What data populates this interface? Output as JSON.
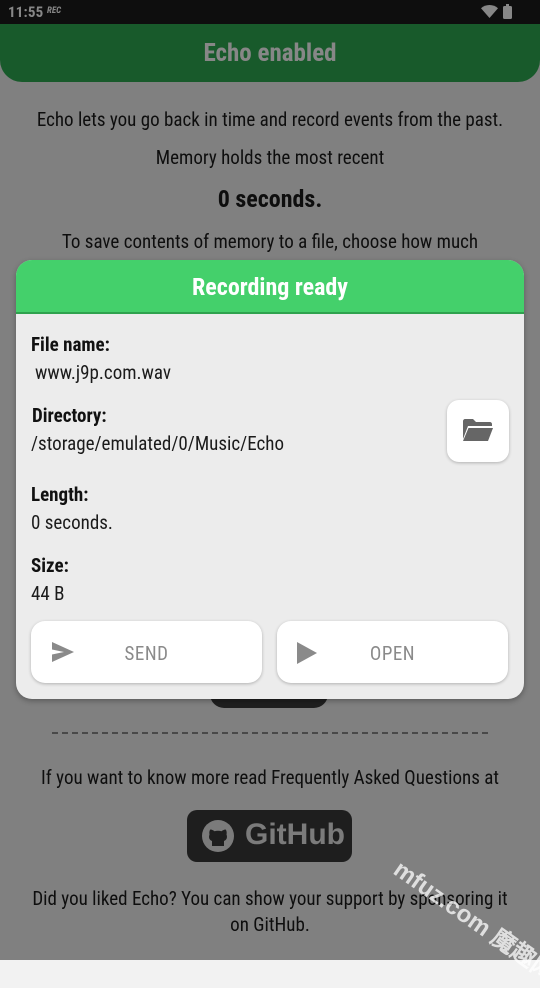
{
  "status_bar": {
    "time": "11:55",
    "rec": "REC"
  },
  "app": {
    "title": "Echo enabled",
    "intro": "Echo lets you go back in time and record events from the past.",
    "memory_label": "Memory holds the most recent",
    "memory_value": "0 seconds.",
    "save_hint": "To save contents of memory to a file, choose how much",
    "faq_text": "If you want to know more read Frequently Asked Questions at",
    "github_label": "GitHub",
    "support_line1": "Did you liked Echo? You can show your support by sponsoring it",
    "support_line2": "on GitHub."
  },
  "dialog": {
    "title": "Recording ready",
    "file_name_label": "File name:",
    "file_name": "www.j9p.com.wav",
    "directory_label": "Directory:",
    "directory": "/storage/emulated/0/Music/Echo",
    "length_label": "Length:",
    "length": "0 seconds.",
    "size_label": "Size:",
    "size": "44 B",
    "send_label": "SEND",
    "open_label": "OPEN"
  },
  "watermark": {
    "text": "mfuz.com 魔趣网"
  },
  "colors": {
    "header": "#2faa52",
    "dialog_header": "#44d06b"
  }
}
